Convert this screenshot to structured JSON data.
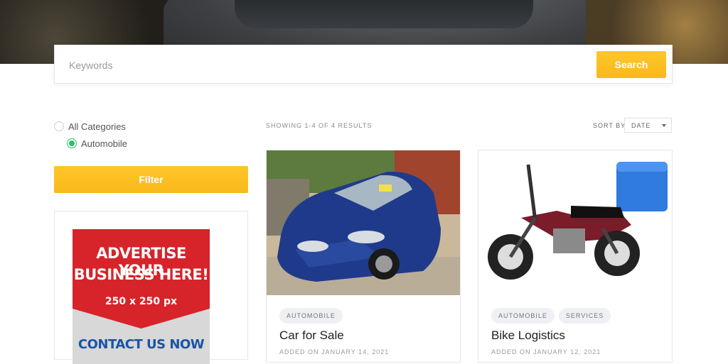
{
  "search": {
    "placeholder": "Keywords",
    "button_label": "Search"
  },
  "categories": [
    {
      "label": "All Categories",
      "checked": false
    },
    {
      "label": "Automobile",
      "checked": true
    }
  ],
  "filter": {
    "button_label": "Filter"
  },
  "ad": {
    "line1": "ADVERTISE YOUR",
    "line2": "BUSINESS HERE!",
    "size": "250 x 250 px",
    "cta": "CONTACT US NOW"
  },
  "listing": {
    "results_text": "SHOWING 1-4 OF 4 RESULTS",
    "sort_label": "SORT BY",
    "sort_value": "DATE"
  },
  "items": [
    {
      "title": "Car for Sale",
      "tags": [
        "AUTOMOBILE"
      ],
      "date": "ADDED ON JANUARY 14, 2021"
    },
    {
      "title": "Bike Logistics",
      "tags": [
        "AUTOMOBILE",
        "SERVICES"
      ],
      "date": "ADDED ON JANUARY 12, 2021"
    }
  ],
  "colors": {
    "accent": "#f8b91a",
    "radio_checked": "#2ac06d",
    "ad_red": "#d6242a",
    "ad_blue": "#1a54a5"
  }
}
